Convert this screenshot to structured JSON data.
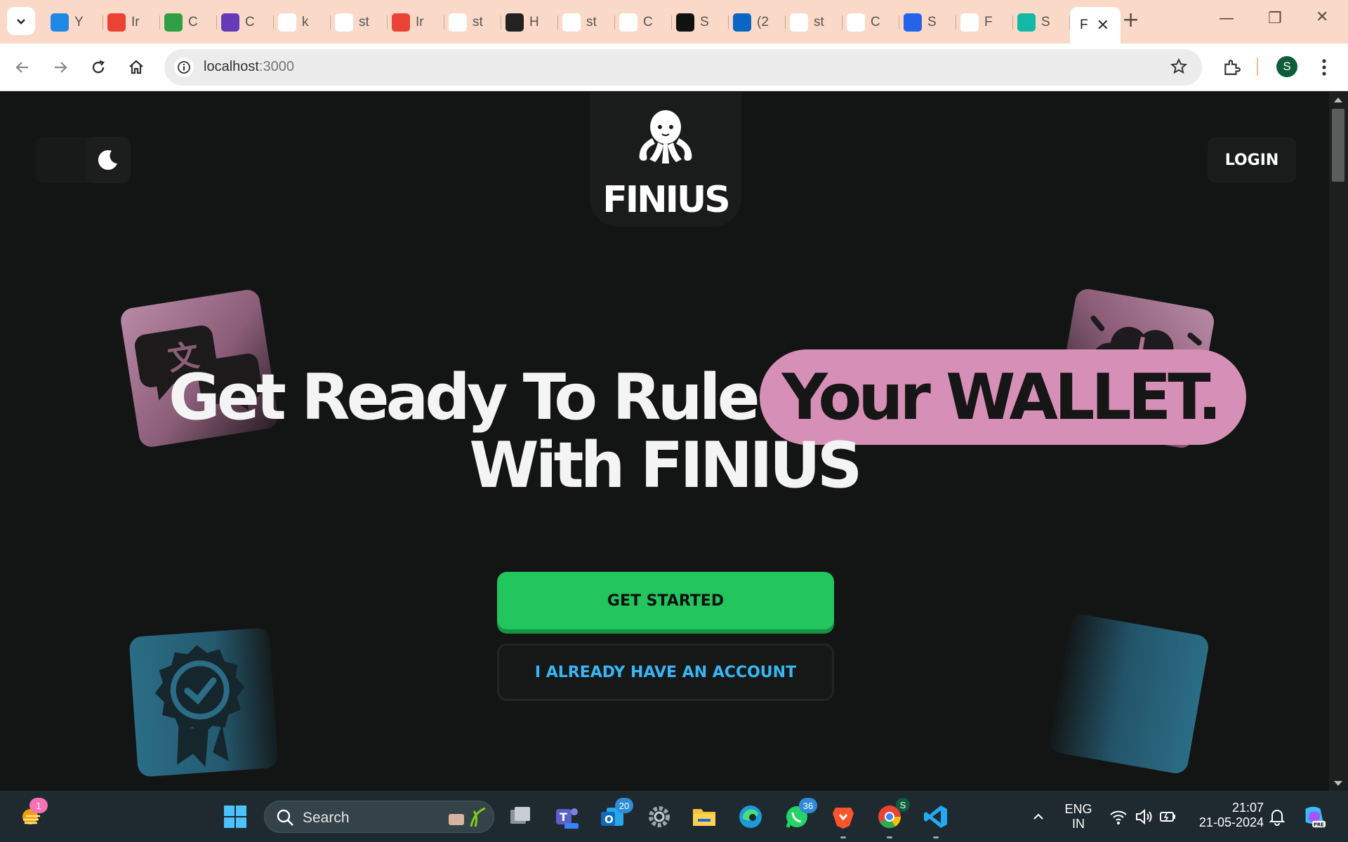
{
  "browser": {
    "tabs": [
      {
        "label": "Y",
        "icon": "s-icon",
        "color": "#1e88e5"
      },
      {
        "label": "Ir",
        "icon": "gmail-icon",
        "color": "#ea4335"
      },
      {
        "label": "C",
        "icon": "infinity-icon",
        "color": "#2ea043"
      },
      {
        "label": "C",
        "icon": "list-icon",
        "color": "#673ab7"
      },
      {
        "label": "k",
        "icon": "github-icon",
        "color": "#ffffff"
      },
      {
        "label": "st",
        "icon": "github-icon",
        "color": "#ffffff"
      },
      {
        "label": "Ir",
        "icon": "gmail-icon",
        "color": "#ea4335"
      },
      {
        "label": "st",
        "icon": "github-icon",
        "color": "#ffffff"
      },
      {
        "label": "H",
        "icon": "dark-app-icon",
        "color": "#222222"
      },
      {
        "label": "st",
        "icon": "github-icon",
        "color": "#ffffff"
      },
      {
        "label": "C",
        "icon": "openai-icon",
        "color": "#ffffff"
      },
      {
        "label": "S",
        "icon": "tw-icon",
        "color": "#111111"
      },
      {
        "label": "(2",
        "icon": "linkedin-icon",
        "color": "#0a66c2"
      },
      {
        "label": "st",
        "icon": "quill-icon",
        "color": "#ffffff"
      },
      {
        "label": "C",
        "icon": "openai-icon",
        "color": "#ffffff"
      },
      {
        "label": "S",
        "icon": "blue-logo-icon",
        "color": "#2563eb"
      },
      {
        "label": "F",
        "icon": "red-logo-icon",
        "color": "#ffffff"
      },
      {
        "label": "S",
        "icon": "v-logo-icon",
        "color": "#14b8a6"
      }
    ],
    "active_tab": {
      "label": "F",
      "close": "✕"
    },
    "new_tab": "+",
    "url_host": "localhost",
    "url_port": ":3000",
    "profile_initial": "S"
  },
  "page": {
    "logo": "FINIUS",
    "login": "LOGIN",
    "hero_part1": "Get Ready To Rule",
    "hero_highlight": "Your WALLET.",
    "hero_line2": "With FINIUS",
    "cta_primary": "GET STARTED",
    "cta_secondary": "I ALREADY HAVE AN ACCOUNT",
    "colors": {
      "accent_green": "#22c55e",
      "accent_pink": "#d68fb6",
      "accent_blue": "#38b6f5",
      "background": "#131514"
    }
  },
  "taskbar": {
    "search_label": "Search",
    "notification_badge": "1",
    "outlook_badge": "20",
    "whatsapp_badge": "36",
    "chrome_badge": "S",
    "lang_line1": "ENG",
    "lang_line2": "IN",
    "time": "21:07",
    "date": "21-05-2024"
  }
}
